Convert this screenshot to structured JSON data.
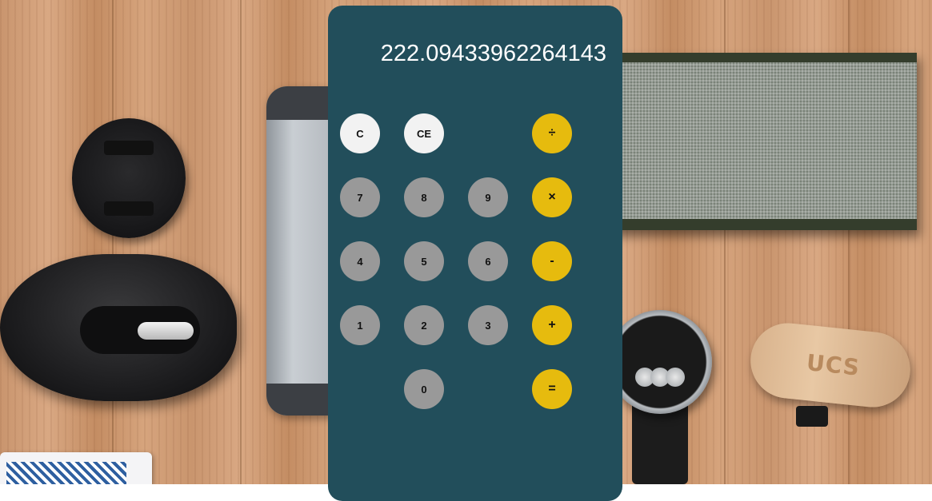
{
  "calculator": {
    "display": "222.09433962264143",
    "buttons": {
      "clear": "C",
      "clear_entry": "CE",
      "divide": "÷",
      "multiply": "×",
      "subtract": "-",
      "add": "+",
      "equals": "=",
      "seven": "7",
      "eight": "8",
      "nine": "9",
      "four": "4",
      "five": "5",
      "six": "6",
      "one": "1",
      "two": "2",
      "three": "3",
      "zero": "0"
    },
    "colors": {
      "panel": "#224e5b",
      "function_button": "#f2f2f2",
      "number_button": "#999999",
      "operator_button": "#e6bb0e"
    }
  },
  "background": {
    "usb_logo": "UCS"
  }
}
